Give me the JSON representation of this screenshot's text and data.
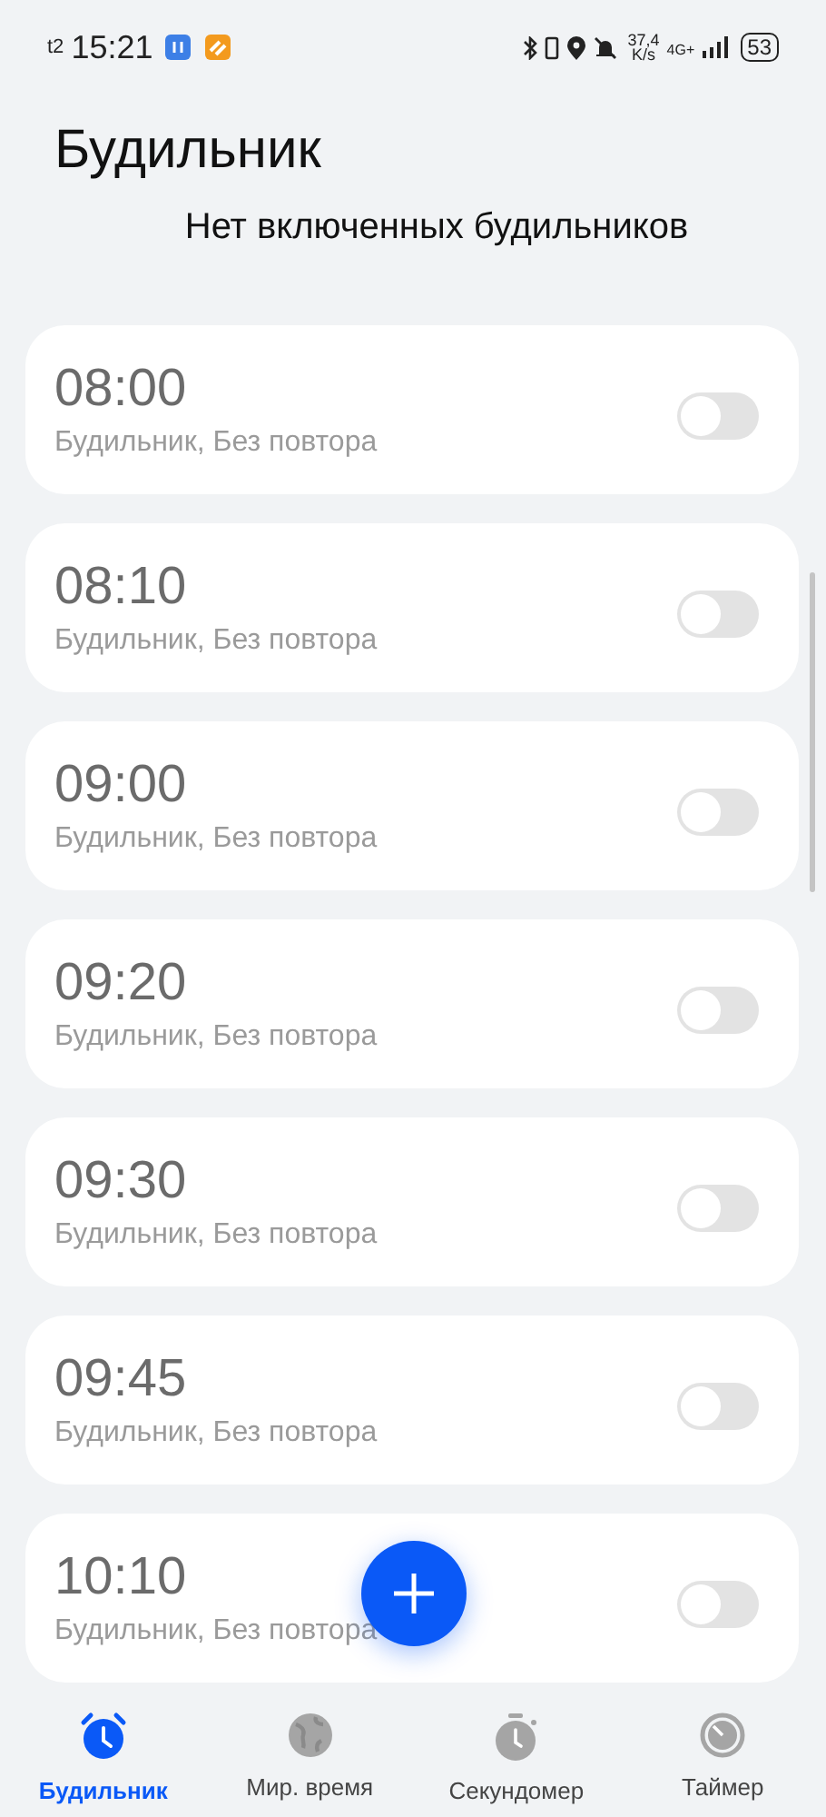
{
  "status_bar": {
    "carrier": "t2",
    "time": "15:21",
    "speed": "37,4",
    "speed_unit": "K/s",
    "network": "4G+",
    "battery": "53"
  },
  "title": "Будильник",
  "subtitle": "Нет включенных будильников",
  "alarms": [
    {
      "time": "08:00",
      "label": "Будильник, Без повтора",
      "on": false
    },
    {
      "time": "08:10",
      "label": "Будильник, Без повтора",
      "on": false
    },
    {
      "time": "09:00",
      "label": "Будильник, Без повтора",
      "on": false
    },
    {
      "time": "09:20",
      "label": "Будильник, Без повтора",
      "on": false
    },
    {
      "time": "09:30",
      "label": "Будильник, Без повтора",
      "on": false
    },
    {
      "time": "09:45",
      "label": "Будильник, Без повтора",
      "on": false
    },
    {
      "time": "10:10",
      "label": "Будильник, Без повтора",
      "on": false
    }
  ],
  "tabs": [
    {
      "kind": "alarm",
      "label": "Будильник",
      "selected": true
    },
    {
      "kind": "world",
      "label": "Мир. время",
      "selected": false
    },
    {
      "kind": "stopwatch",
      "label": "Секундомер",
      "selected": false
    },
    {
      "kind": "timer",
      "label": "Таймер",
      "selected": false
    }
  ]
}
